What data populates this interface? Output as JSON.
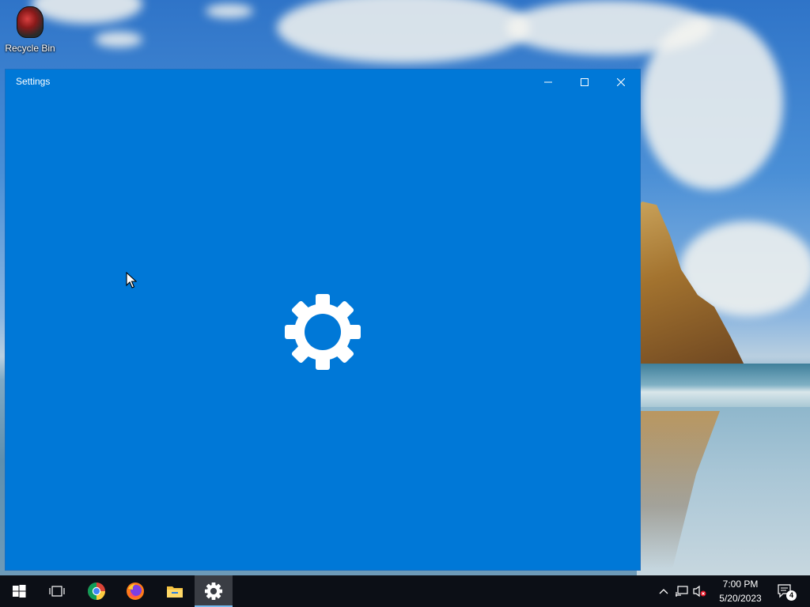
{
  "desktop": {
    "icons": [
      {
        "label": "Recycle Bin",
        "icon": "recycle-bin-icon"
      }
    ]
  },
  "window": {
    "title": "Settings",
    "accent_color": "#0078d7",
    "controls": {
      "minimize": "minimize-icon",
      "maximize": "maximize-icon",
      "close": "close-icon"
    },
    "splash_icon": "gear-icon"
  },
  "taskbar": {
    "background": "#0c0f16",
    "buttons": [
      {
        "name": "start",
        "icon": "windows-logo-icon"
      },
      {
        "name": "task-view",
        "icon": "task-view-icon"
      },
      {
        "name": "chrome",
        "icon": "chrome-icon"
      },
      {
        "name": "firefox",
        "icon": "firefox-icon"
      },
      {
        "name": "file-explorer",
        "icon": "folder-icon"
      },
      {
        "name": "settings",
        "icon": "gear-icon",
        "active": true
      }
    ],
    "tray": {
      "icons": [
        "chevron-up-icon",
        "network-icon",
        "volume-muted-icon"
      ],
      "time": "7:00 PM",
      "date": "5/20/2023",
      "notifications": "4"
    }
  }
}
